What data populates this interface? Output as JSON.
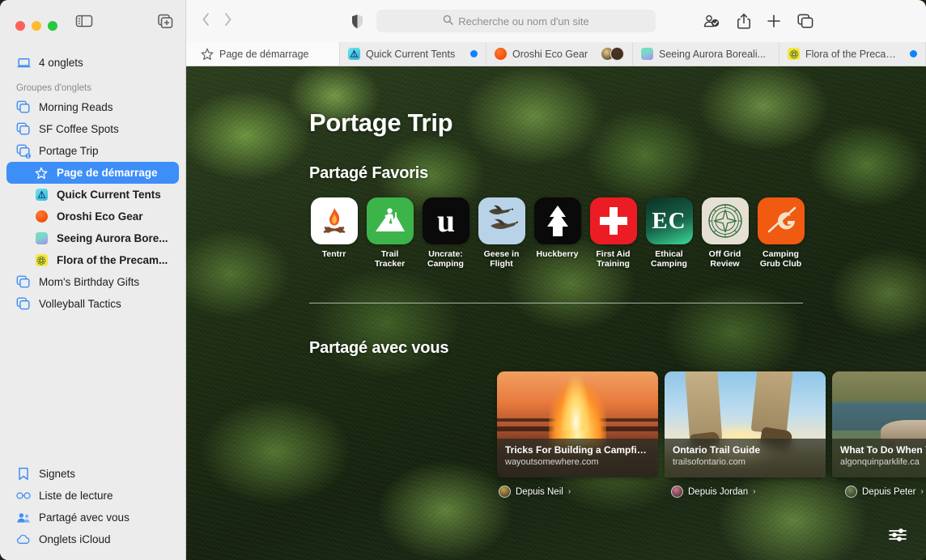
{
  "window": {
    "traffic_lights": [
      "close",
      "minimize",
      "zoom"
    ],
    "sidebar_toggle_icon": "sidebar-icon",
    "new_tab_group_icon": "new-tab-group-icon"
  },
  "sidebar": {
    "tabs_count_label": "4 onglets",
    "tabs_count_icon": "laptop-icon",
    "groups_header": "Groupes d'onglets",
    "groups": [
      {
        "label": "Morning Reads",
        "icon": "tab-group-icon",
        "selected": false
      },
      {
        "label": "SF Coffee Spots",
        "icon": "tab-group-icon",
        "selected": false
      },
      {
        "label": "Portage Trip",
        "icon": "tab-group-shared-icon",
        "selected": false
      }
    ],
    "portage_tabs": [
      {
        "label": "Page de démarrage",
        "icon": "star-icon",
        "selected": true,
        "favcolor": ""
      },
      {
        "label": "Quick Current Tents",
        "icon": "site-favicon",
        "selected": false,
        "favcolor": "#5ad7e0"
      },
      {
        "label": "Oroshi Eco Gear",
        "icon": "site-favicon",
        "selected": false,
        "favcolor": "#f83600"
      },
      {
        "label": "Seeing Aurora Bore...",
        "icon": "site-favicon",
        "selected": false,
        "favcolor": "#6fe3b4"
      },
      {
        "label": "Flora of the Precam...",
        "icon": "site-favicon",
        "selected": false,
        "favcolor": "#f5e642"
      }
    ],
    "groups_after": [
      {
        "label": "Mom's Birthday Gifts",
        "icon": "tab-group-icon",
        "selected": false
      },
      {
        "label": "Volleyball Tactics",
        "icon": "tab-group-icon",
        "selected": false
      }
    ],
    "bottom_items": [
      {
        "label": "Signets",
        "icon": "bookmark-icon"
      },
      {
        "label": "Liste de lecture",
        "icon": "glasses-icon"
      },
      {
        "label": "Partagé avec vous",
        "icon": "shared-with-you-icon"
      },
      {
        "label": "Onglets iCloud",
        "icon": "cloud-icon"
      }
    ]
  },
  "toolbar": {
    "back_icon": "chevron-left-icon",
    "forward_icon": "chevron-right-icon",
    "shield_icon": "privacy-shield-icon",
    "search_placeholder": "Recherche ou nom d'un site",
    "search_icon": "search-icon",
    "share_participants_icon": "share-participants-icon",
    "share_icon": "share-icon",
    "new_tab_icon": "plus-icon",
    "tab_overview_icon": "tab-overview-icon"
  },
  "tabbar": {
    "tabs": [
      {
        "label": "Page de démarrage",
        "icon": "star-icon",
        "kind": "start",
        "dot": false,
        "favcolor": ""
      },
      {
        "label": "Quick Current Tents",
        "icon": "site-favicon",
        "kind": "normal",
        "dot": true,
        "favcolor": "#5ad7e0"
      },
      {
        "label": "Oroshi Eco Gear",
        "icon": "site-favicon",
        "kind": "normal",
        "dot": false,
        "favcolor": "#f83600",
        "avatars": [
          "#e8c98a",
          "#4a3526"
        ]
      },
      {
        "label": "Seeing Aurora Boreali...",
        "icon": "site-favicon",
        "kind": "normal",
        "dot": false,
        "favcolor": "#6fe3b4"
      },
      {
        "label": "Flora of the Precambi...",
        "icon": "site-favicon",
        "kind": "normal",
        "dot": true,
        "favcolor": "#f5e642"
      }
    ]
  },
  "start_page": {
    "title": "Portage Trip",
    "favorites_heading": "Partagé Favoris",
    "favorites": [
      {
        "name": "Tentrr",
        "icon": "campfire-icon",
        "bg": "#ffffff",
        "fg": "#f05a23"
      },
      {
        "name": "Trail\nTracker",
        "icon": "hiker-icon",
        "bg": "#3cb44a",
        "fg": "#ffffff"
      },
      {
        "name": "Uncrate:\nCamping",
        "icon": "letter-u-icon",
        "bg": "#0a0a0a",
        "fg": "#ffffff"
      },
      {
        "name": "Geese in\nFlight",
        "icon": "geese-icon",
        "bg": "#b8d3e8",
        "fg": "#2e2a23"
      },
      {
        "name": "Huckberry",
        "icon": "pine-tree-icon",
        "bg": "#0a0a0a",
        "fg": "#ffffff"
      },
      {
        "name": "First Aid\nTraining",
        "icon": "red-cross-icon",
        "bg": "#ec1c24",
        "fg": "#ffffff"
      },
      {
        "name": "Ethical\nCamping",
        "icon": "letters-ec-icon",
        "bg": "#0b3d2e",
        "fg": "#ffffff"
      },
      {
        "name": "Off Grid\nReview",
        "icon": "compass-icon",
        "bg": "#e6e0d4",
        "fg": "#2f6b3a"
      },
      {
        "name": "Camping\nGrub Club",
        "icon": "cg-monogram-icon",
        "bg": "#f05a11",
        "fg": "#f0e4c8"
      }
    ],
    "shared_heading": "Partagé avec vous",
    "shared_cards": [
      {
        "title": "Tricks For Building a Campfire—F...",
        "host": "wayoutsomewhere.com",
        "image": "campfire-photo",
        "from_label": "Depuis Neil",
        "from_avatar_color": "#c8a24a",
        "chevron": "›"
      },
      {
        "title": "Ontario Trail Guide",
        "host": "trailsofontario.com",
        "image": "hiking-boots-photo",
        "from_label": "Depuis Jordan",
        "from_avatar_color": "#d4738f",
        "chevron": "›"
      },
      {
        "title": "What To Do When You See a Moo...",
        "host": "algonquinparklife.ca",
        "image": "elk-photo",
        "from_label": "Depuis Peter",
        "from_avatar_color": "#6f8f5a",
        "chevron": "›"
      }
    ],
    "settings_icon": "sliders-icon"
  },
  "colors": {
    "accent": "#3e8ef7",
    "sidebar_bg": "#ececec",
    "toolbar_bg": "#f7f7f7",
    "blue_dot": "#0a84ff"
  }
}
